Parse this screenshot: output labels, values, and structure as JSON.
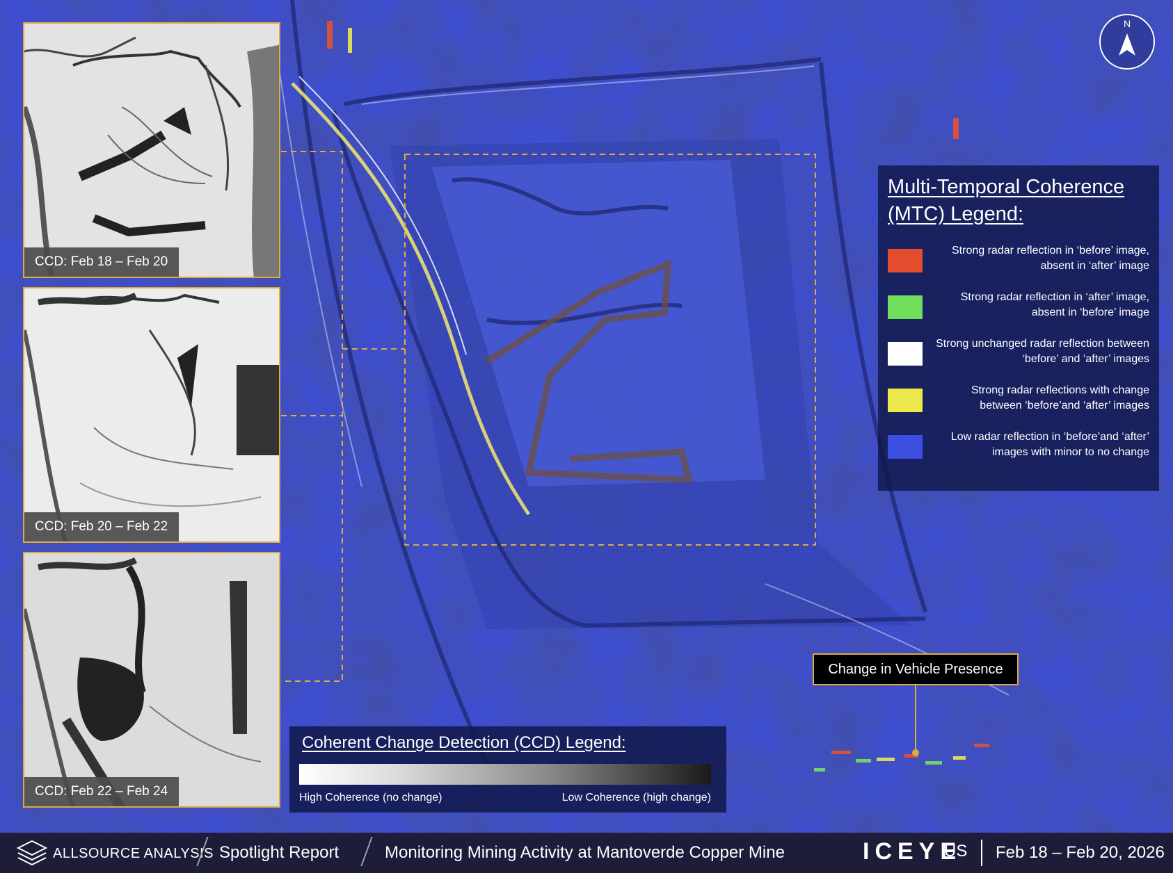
{
  "sar_image": {
    "name": "Mantoverde Copper Mine SAR composite"
  },
  "insets": [
    {
      "caption": "CCD: Feb 18 – Feb 20"
    },
    {
      "caption": "CCD: Feb 20 – Feb 22"
    },
    {
      "caption": "CCD: Feb 22 – Feb 24"
    }
  ],
  "mtc_legend": {
    "title": "Multi-Temporal Coherence (MTC) Legend:",
    "items": [
      {
        "color": "#e34c2d",
        "label": "Strong radar reflection in ‘before’ image, absent in ‘after’ image"
      },
      {
        "color": "#6fe05c",
        "label": "Strong radar reflection in ‘after’ image, absent in ‘before’ image"
      },
      {
        "color": "#ffffff",
        "label": "Strong unchanged radar reflection between ‘before’ and ‘after’ images"
      },
      {
        "color": "#ece84c",
        "label": "Strong radar reflections with change between ‘before’and ‘after’ images"
      },
      {
        "color": "#3c4fe0",
        "label": "Low radar reflection in ‘before’and ‘after’ images with minor to no change"
      }
    ]
  },
  "ccd_legend": {
    "title": "Coherent Change Detection (CCD) Legend:",
    "low_label": "High Coherence (no change)",
    "high_label": "Low Coherence (high change)"
  },
  "callout": {
    "label": "Change in Vehicle Presence"
  },
  "north_arrow": {
    "letter": "N"
  },
  "footer": {
    "brand": "ALLSOURCE ANALYSIS",
    "report": "Spotlight Report",
    "title": "Monitoring Mining Activity at Mantoverde Copper Mine",
    "partner": "ICEYE",
    "partner_suffix": "US",
    "date_range": "Feb 18 – Feb 20, 2026"
  },
  "colors": {
    "accent": "#e0a93a",
    "sar_blue": "#3444c8"
  }
}
